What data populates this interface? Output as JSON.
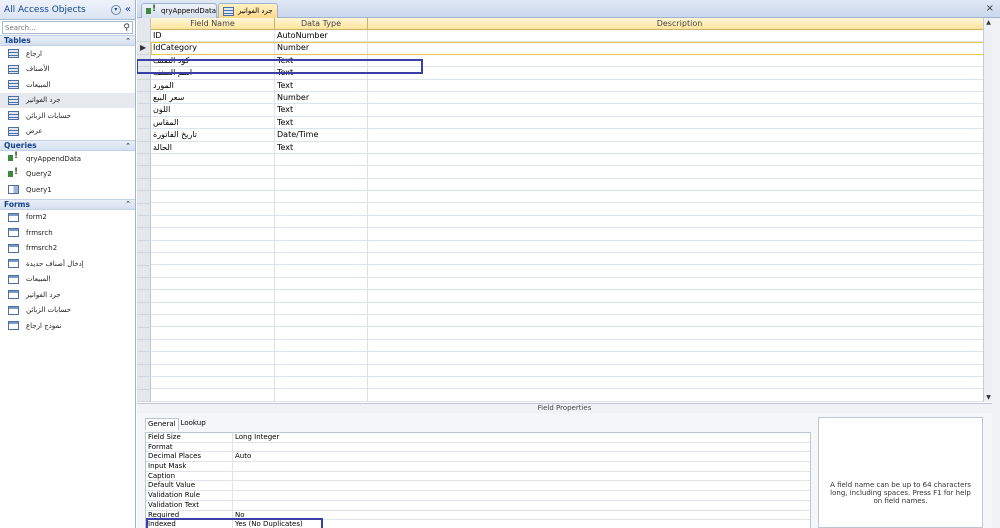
{
  "nav": {
    "title": "All Access Objects",
    "search_placeholder": "Search...",
    "groups": {
      "tables": {
        "label": "Tables",
        "items": [
          "ارجاع",
          "الأصناف",
          "المبيعات",
          "جرد الفواتير",
          "حسابات الزبائن",
          "عرض"
        ]
      },
      "queries": {
        "label": "Queries",
        "items": [
          "qryAppendData",
          "Query2",
          "Query1"
        ]
      },
      "forms": {
        "label": "Forms",
        "items": [
          "form2",
          "frmsrch",
          "frmsrch2",
          "إدخال أصناف جديدة",
          "المبيعات",
          "جرد الفواتير",
          "حسابات الزبائن",
          "نموذج ارجاع"
        ]
      }
    },
    "selected_item": "جرد الفواتير"
  },
  "tabs": {
    "tab1": "qryAppendData",
    "tab2": "جرد الفواتير",
    "close_glyph": "×"
  },
  "grid": {
    "headers": [
      "Field Name",
      "Data Type",
      "Description"
    ],
    "rows": [
      [
        "ID",
        "AutoNumber",
        ""
      ],
      [
        "IdCategory",
        "Number",
        ""
      ],
      [
        "كود الصنف",
        "Text",
        ""
      ],
      [
        "اسم الصنف",
        "Text",
        ""
      ],
      [
        "المورد",
        "Text",
        ""
      ],
      [
        "سعر البيع",
        "Number",
        ""
      ],
      [
        "اللون",
        "Text",
        ""
      ],
      [
        "المقاس",
        "Text",
        ""
      ],
      [
        "تاريخ الفاتورة",
        "Date/Time",
        ""
      ],
      [
        "الحالة",
        "Text",
        ""
      ]
    ],
    "current_row": 1
  },
  "field_properties": {
    "title": "Field Properties",
    "tabs": [
      "General",
      "Lookup"
    ],
    "rows": [
      [
        "Field Size",
        "Long Integer"
      ],
      [
        "Format",
        ""
      ],
      [
        "Decimal Places",
        "Auto"
      ],
      [
        "Input Mask",
        ""
      ],
      [
        "Caption",
        ""
      ],
      [
        "Default Value",
        ""
      ],
      [
        "Validation Rule",
        ""
      ],
      [
        "Validation Text",
        ""
      ],
      [
        "Required",
        "No"
      ],
      [
        "Indexed",
        "Yes (No Duplicates)"
      ]
    ],
    "help_text": "A field name can be up to 64 characters long, including spaces. Press F1 for help on field names."
  },
  "colors": {
    "highlight_box": "#3b3fa6",
    "nav_header_text": "#15428b",
    "active_tab": "#ffd98a"
  }
}
